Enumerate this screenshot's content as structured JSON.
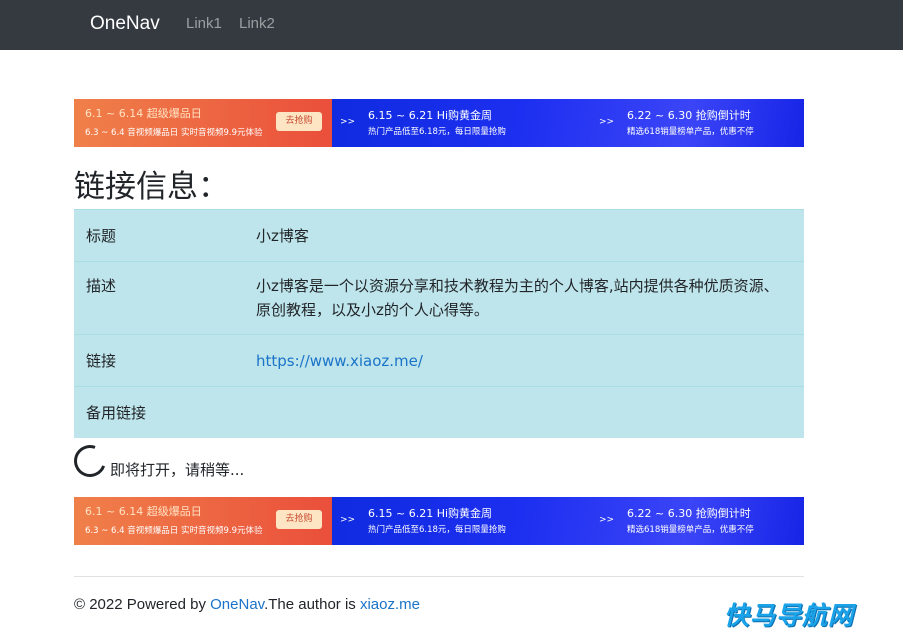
{
  "navbar": {
    "brand": "OneNav",
    "links": [
      "Link1",
      "Link2"
    ]
  },
  "banner": {
    "segments": [
      {
        "title": "6.1 ~ 6.14 超级爆品日",
        "subtitle": "6.3 ~ 6.4 音视频爆品日 实时音视频9.9元体验",
        "button": "去抢购"
      },
      {
        "arrow": ">>",
        "title": "6.15 ~ 6.21 Hi购黄金周",
        "subtitle": "热门产品低至6.18元，每日限量抢购"
      },
      {
        "arrow": ">>",
        "title": "6.22 ~ 6.30 抢购倒计时",
        "subtitle": "精选618销量榜单产品，优惠不停"
      }
    ]
  },
  "heading": "链接信息：",
  "info": {
    "rows": [
      {
        "label": "标题",
        "value": "小z博客"
      },
      {
        "label": "描述",
        "value": "小z博客是一个以资源分享和技术教程为主的个人博客,站内提供各种优质资源、原创教程，以及小z的个人心得等。"
      },
      {
        "label": "链接",
        "value": "https://www.xiaoz.me/"
      },
      {
        "label": "备用链接",
        "value": ""
      }
    ]
  },
  "loading_text": "即将打开，请稍等...",
  "footer": {
    "prefix": "© 2022 Powered by ",
    "onenav_link": "OneNav",
    "middle": ".The author is ",
    "author_link": "xiaoz.me"
  },
  "watermark": "快马导航网",
  "colors": {
    "navbar_bg": "#343a40",
    "table_bg": "#bee5eb",
    "link": "#1a73c8",
    "banner_orange": "#ea4f3b",
    "banner_blue": "#1d2ff0"
  }
}
